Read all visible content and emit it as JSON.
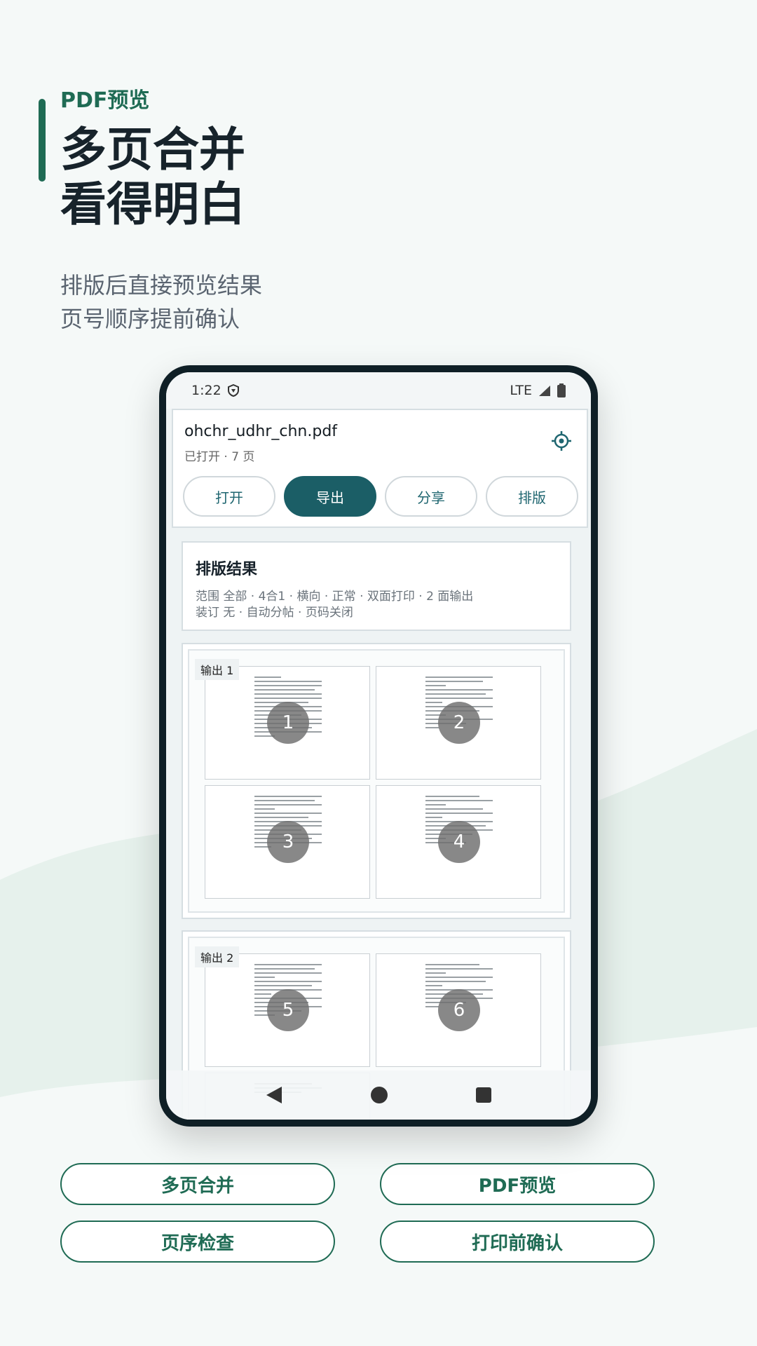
{
  "hero": {
    "kicker": "PDF预览",
    "title_line1": "多页合并",
    "title_line2": "看得明白",
    "subtitle_line1": "排版后直接预览结果",
    "subtitle_line2": "页号顺序提前确认"
  },
  "status_bar": {
    "time": "1:22",
    "network": "LTE"
  },
  "file": {
    "name": "ohchr_udhr_chn.pdf",
    "meta": "已打开 · 7 页"
  },
  "actions": [
    {
      "label": "打开",
      "primary": false
    },
    {
      "label": "导出",
      "primary": true
    },
    {
      "label": "分享",
      "primary": false
    },
    {
      "label": "排版",
      "primary": false
    }
  ],
  "layout_result": {
    "title": "排版结果",
    "line1": "范围 全部 · 4合1 · 横向 · 正常 · 双面打印 · 2 面输出",
    "line2": "装订 无 · 自动分帖 · 页码关闭"
  },
  "outputs": [
    {
      "label": "输出 1",
      "pages": [
        "1",
        "2",
        "3",
        "4"
      ]
    },
    {
      "label": "输出 2",
      "pages": [
        "5",
        "6"
      ]
    }
  ],
  "feature_tags": [
    "多页合并",
    "PDF预览",
    "页序检查",
    "打印前确认"
  ],
  "colors": {
    "brand_green": "#1f6b54",
    "primary_button": "#1b5e66",
    "background": "#f5f9f8",
    "wave": "#e6f1ec"
  },
  "icons": {
    "settings": "gear-icon",
    "back": "back-triangle-icon",
    "home": "home-circle-icon",
    "recents": "recents-square-icon"
  }
}
